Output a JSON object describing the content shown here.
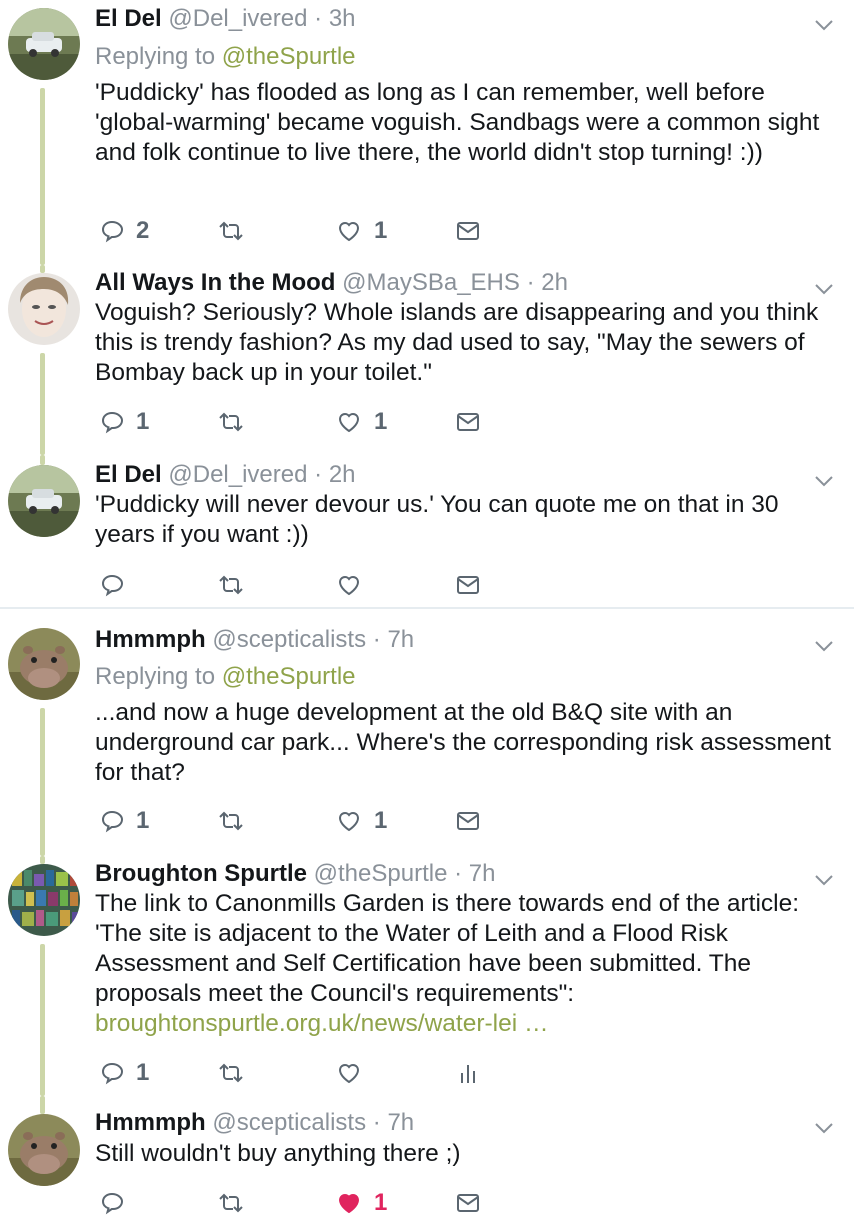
{
  "tweets": [
    {
      "name": "El Del",
      "handle": "@Del_ivered",
      "time": "3h",
      "replying_prefix": "Replying to",
      "replying_to": "@theSpurtle",
      "body": "'Puddicky' has flooded as long as I can remember, well before 'global-warming' became voguish. Sandbags were a common sight and folk continue to live there, the world didn't stop turning! :))",
      "replies": "2",
      "retweets": "",
      "likes": "1"
    },
    {
      "name": "All Ways In the Mood",
      "handle": "@MaySBa_EHS",
      "time": "2h",
      "body": "Voguish?   Seriously?  Whole islands are disappearing and you think this is trendy fashion?  As my dad used to say, \"May the sewers of Bombay back up in your toilet.\"",
      "replies": "1",
      "retweets": "",
      "likes": "1"
    },
    {
      "name": "El Del",
      "handle": "@Del_ivered",
      "time": "2h",
      "body": "'Puddicky will never devour us.' You can quote me on that in 30 years if you want :))",
      "replies": "",
      "retweets": "",
      "likes": ""
    },
    {
      "name": "Hmmmph",
      "handle": "@scepticalists",
      "time": "7h",
      "replying_prefix": "Replying to",
      "replying_to": "@theSpurtle",
      "body": "...and now a huge development at the old B&Q site with an underground car park... Where's the corresponding risk assessment for that?",
      "replies": "1",
      "retweets": "",
      "likes": "1"
    },
    {
      "name": "Broughton Spurtle",
      "handle": "@theSpurtle",
      "time": "7h",
      "body": "The link to Canonmills Garden is there towards end of the article: 'The site is adjacent to the Water of Leith and a Flood Risk Assessment and Self Certification have been submitted. The proposals meet the Council's requirements\":",
      "link": "broughtonspurtle.org.uk/news/water-lei  …",
      "replies": "1",
      "retweets": "",
      "likes": ""
    },
    {
      "name": "Hmmmph",
      "handle": "@scepticalists",
      "time": "7h",
      "body": "Still wouldn't buy anything there ;)",
      "replies": "",
      "retweets": "",
      "likes": "1"
    }
  ],
  "separator": "·",
  "icons": {
    "reply": "reply-icon",
    "retweet": "retweet-icon",
    "like": "heart-icon",
    "liked": "heart-filled-icon",
    "dm": "envelope-icon",
    "analytics": "analytics-icon",
    "more": "chevron-down-icon"
  },
  "colors": {
    "accent_link": "#8fa34a",
    "muted": "#8a9199",
    "liked": "#e0245e",
    "thread_line": "#ccd6a8"
  }
}
